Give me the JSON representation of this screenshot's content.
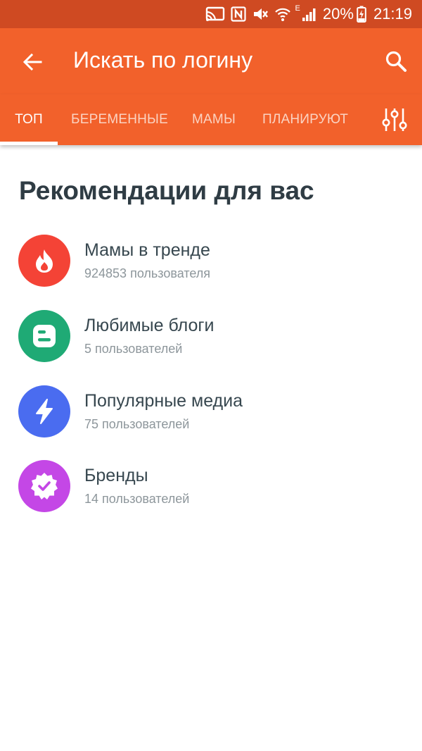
{
  "status_bar": {
    "battery": "20%",
    "time": "21:19",
    "network_label": "E",
    "icons": [
      "cast-icon",
      "nfc-icon",
      "mute-icon",
      "wifi-icon",
      "signal-icon",
      "battery-charging-icon"
    ]
  },
  "toolbar": {
    "title": "Искать по логину",
    "back_icon": "arrow-left-icon",
    "search_icon": "search-icon"
  },
  "tabs": {
    "items": [
      {
        "label": "ТОП",
        "active": true
      },
      {
        "label": "БЕРЕМЕННЫЕ",
        "active": false
      },
      {
        "label": "МАМЫ",
        "active": false
      },
      {
        "label": "ПЛАНИРУЮТ",
        "active": false
      }
    ],
    "filter_icon": "sliders-icon"
  },
  "recommendations": {
    "title": "Рекомендации для вас",
    "items": [
      {
        "name": "Мамы в тренде",
        "count": "924853 пользователя",
        "icon": "fire-icon",
        "color": "#f44336"
      },
      {
        "name": "Любимые блоги",
        "count": "5 пользователей",
        "icon": "blog-icon",
        "color": "#1faa75"
      },
      {
        "name": "Популярные медиа",
        "count": "75 пользователей",
        "icon": "lightning-icon",
        "color": "#4a6cf0"
      },
      {
        "name": "Бренды",
        "count": "14 пользователей",
        "icon": "verified-badge-icon",
        "color": "#c447e6"
      }
    ]
  },
  "colors": {
    "accent": "#f2612b",
    "status_bar": "#cf4a22",
    "title_text": "#2f3c44",
    "secondary_text": "#8d969b"
  }
}
